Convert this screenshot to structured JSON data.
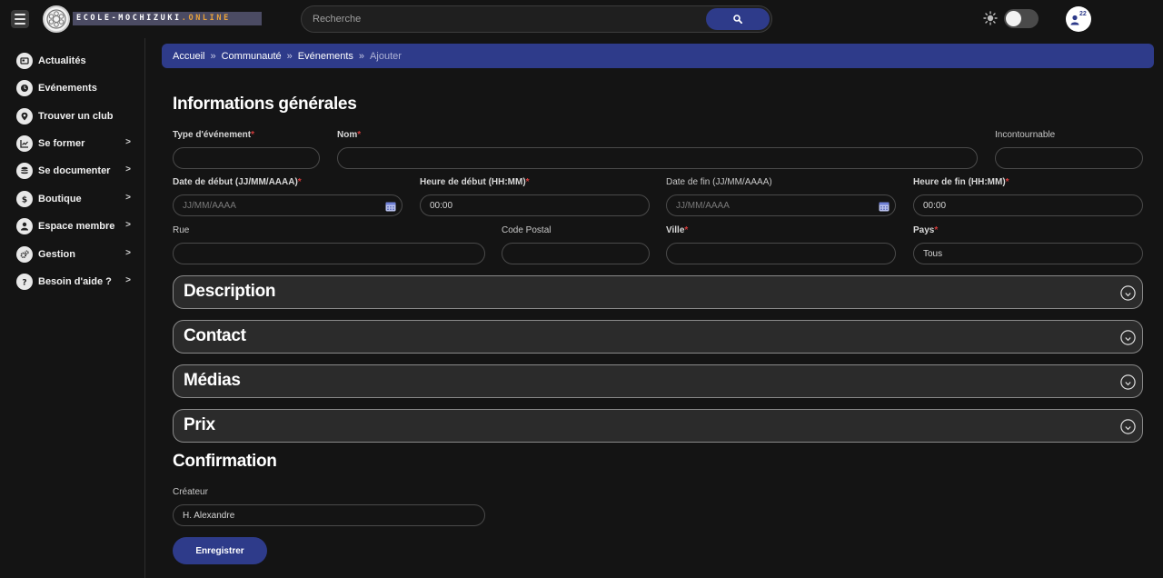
{
  "header": {
    "logo_text_main": "ECOLE-MOCHIZUKI",
    "logo_text_accent": ".ONLINE",
    "search_placeholder": "Recherche",
    "notification_count": "22"
  },
  "sidebar": {
    "items": [
      {
        "label": "Actualités",
        "icon": "newspaper-icon",
        "arrow": ""
      },
      {
        "label": "Evénements",
        "icon": "clock-icon",
        "arrow": ""
      },
      {
        "label": "Trouver un club",
        "icon": "map-pin-icon",
        "arrow": ""
      },
      {
        "label": "Se former",
        "icon": "chart-icon",
        "arrow": ">"
      },
      {
        "label": "Se documenter",
        "icon": "database-icon",
        "arrow": ">"
      },
      {
        "label": "Boutique",
        "icon": "dollar-icon",
        "arrow": ">"
      },
      {
        "label": "Espace membre",
        "icon": "user-icon",
        "arrow": ">"
      },
      {
        "label": "Gestion",
        "icon": "gears-icon",
        "arrow": ">"
      },
      {
        "label": "Besoin d'aide ?",
        "icon": "question-icon",
        "arrow": ">"
      }
    ]
  },
  "breadcrumb": {
    "items": [
      "Accueil",
      "Communauté",
      "Evénements"
    ],
    "separator": "»",
    "current": "Ajouter"
  },
  "form": {
    "general_title": "Informations générales",
    "required_marker": "*",
    "labels": {
      "event_type": "Type d'événement",
      "name": "Nom",
      "must_see": "Incontournable",
      "start_date": "Date de début (JJ/MM/AAAA)",
      "start_time": "Heure de début (HH:MM)",
      "end_date": "Date de fin (JJ/MM/AAAA)",
      "end_time": "Heure de fin (HH:MM)",
      "street": "Rue",
      "postal_code": "Code Postal",
      "city": "Ville",
      "country": "Pays"
    },
    "values": {
      "start_date_placeholder": "JJ/MM/AAAA",
      "start_time": "00:00",
      "end_date_placeholder": "JJ/MM/AAAA",
      "end_time": "00:00",
      "country": "Tous"
    },
    "accordions": [
      "Description",
      "Contact",
      "Médias",
      "Prix"
    ],
    "confirmation_title": "Confirmation",
    "creator_label": "Créateur",
    "creator_value": "H. Alexandre",
    "save_label": "Enregistrer"
  },
  "colors": {
    "accent": "#2e3b8a",
    "background": "#141414",
    "required": "#d23b3b"
  }
}
